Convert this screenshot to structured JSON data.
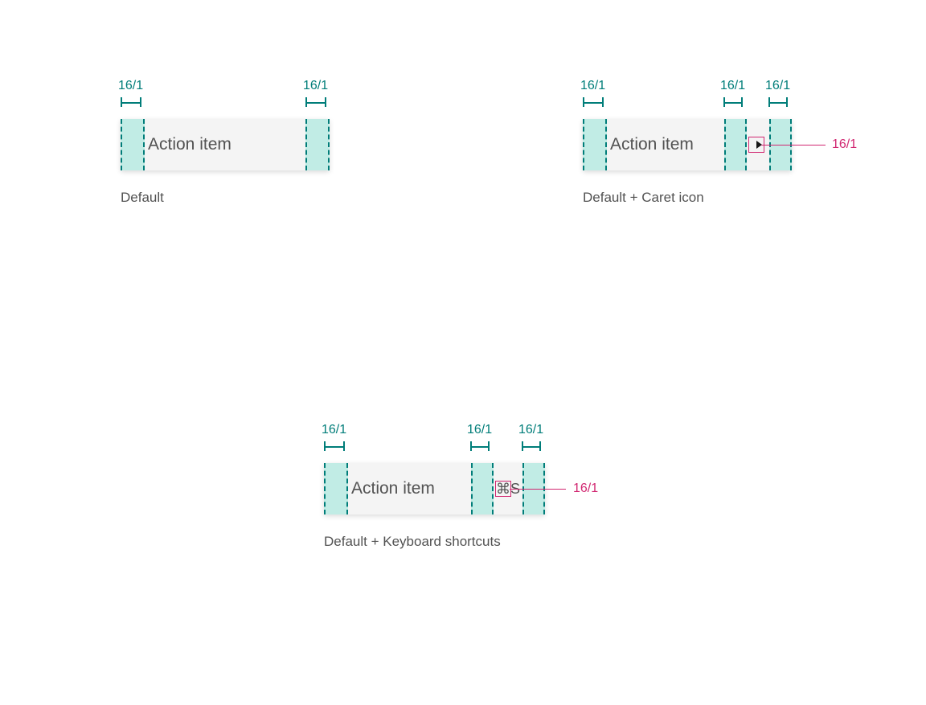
{
  "spacing_token": "16/1",
  "item_label": "Action item",
  "shortcut_text": "⌘S",
  "captions": {
    "default": "Default",
    "caret": "Default + Caret icon",
    "shortcuts": "Default + Keyboard shortcuts"
  },
  "callout_token": "16/1"
}
